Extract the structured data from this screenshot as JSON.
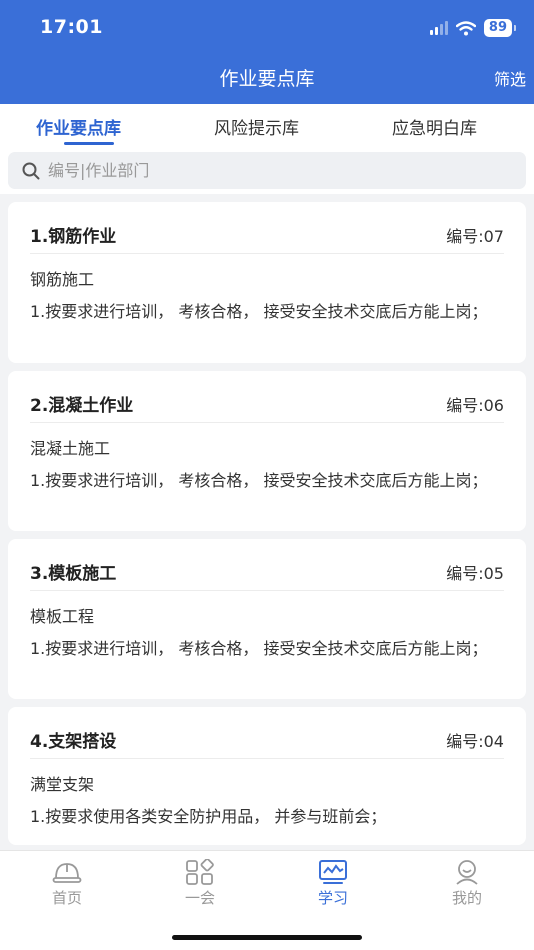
{
  "status": {
    "time": "17:01",
    "battery": "89"
  },
  "nav": {
    "title": "作业要点库",
    "filter": "筛选"
  },
  "tabs": [
    {
      "label": "作业要点库",
      "active": true
    },
    {
      "label": "风险提示库",
      "active": false
    },
    {
      "label": "应急明白库",
      "active": false
    }
  ],
  "search": {
    "placeholder": "编号|作业部门",
    "value": ""
  },
  "cards": [
    {
      "title": "1.钢筋作业",
      "code": "编号:07",
      "subtitle": "钢筋施工",
      "desc": "1.按要求进行培训， 考核合格， 接受安全技术交底后方能上岗；"
    },
    {
      "title": "2.混凝土作业",
      "code": "编号:06",
      "subtitle": "混凝土施工",
      "desc": "1.按要求进行培训， 考核合格， 接受安全技术交底后方能上岗；"
    },
    {
      "title": "3.模板施工",
      "code": "编号:05",
      "subtitle": "模板工程",
      "desc": "1.按要求进行培训， 考核合格， 接受安全技术交底后方能上岗；"
    },
    {
      "title": "4.支架搭设",
      "code": "编号:04",
      "subtitle": "满堂支架",
      "desc": "1.按要求使用各类安全防护用品， 并参与班前会；"
    }
  ],
  "bottom_nav": [
    {
      "label": "首页",
      "icon": "helmet-icon",
      "active": false
    },
    {
      "label": "一会",
      "icon": "grid-icon",
      "active": false
    },
    {
      "label": "学习",
      "icon": "chart-monitor-icon",
      "active": true
    },
    {
      "label": "我的",
      "icon": "user-icon",
      "active": false
    }
  ],
  "colors": {
    "primary": "#3a6fd8",
    "tab_active": "#2e64d1",
    "inactive": "#999999"
  }
}
